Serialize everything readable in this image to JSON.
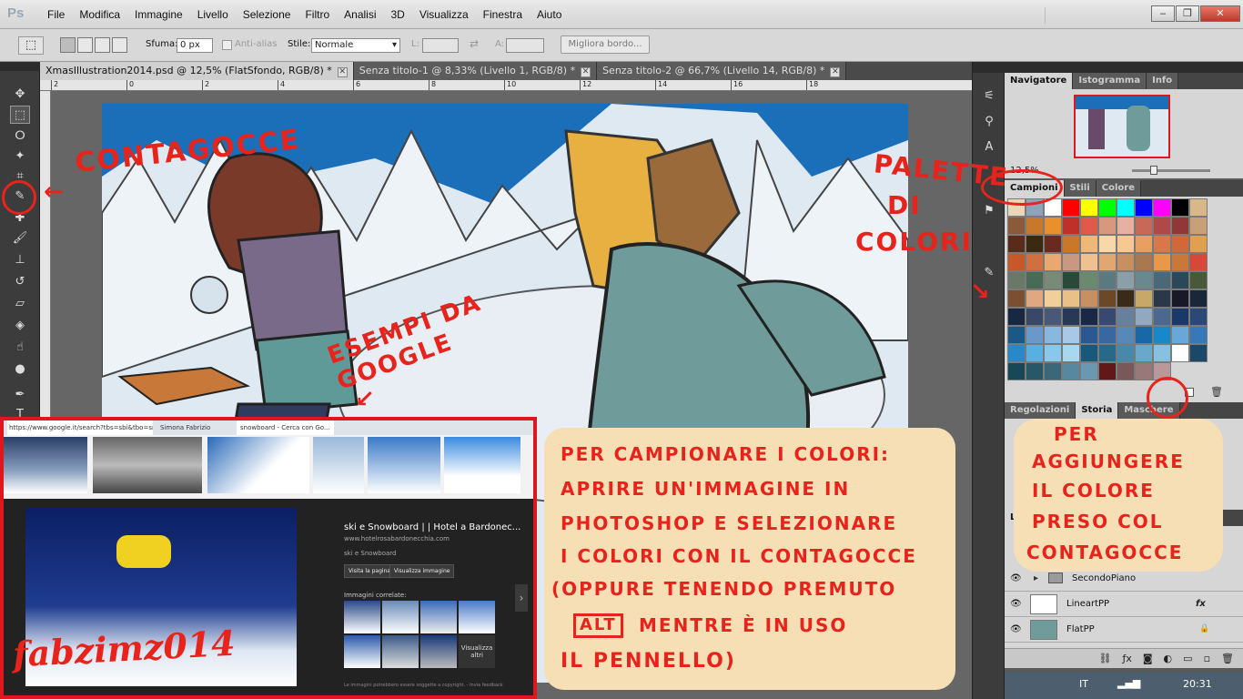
{
  "app": {
    "logo": "Ps"
  },
  "menu": [
    "File",
    "Modifica",
    "Immagine",
    "Livello",
    "Selezione",
    "Filtro",
    "Analisi",
    "3D",
    "Visualizza",
    "Finestra",
    "Aiuto"
  ],
  "options": {
    "feather_label": "Sfuma:",
    "feather_value": "0 px",
    "antialias_label": "Anti-alias",
    "style_label": "Stile:",
    "style_value": "Normale",
    "width_label": "L:",
    "height_label": "A:",
    "refine_button": "Migliora bordo..."
  },
  "tabs": [
    "XmasIllustration2014.psd @ 12,5% (FlatSfondo, RGB/8) *",
    "Senza titolo-1 @ 8,33% (Livello 1, RGB/8) *",
    "Senza titolo-2 @ 66,7% (Livello 14, RGB/8) *"
  ],
  "ruler_ticks": [
    "2",
    "0",
    "2",
    "4",
    "6",
    "8",
    "10",
    "12",
    "14",
    "16",
    "18"
  ],
  "navigator": {
    "tabs": [
      "Navigatore",
      "Istogramma",
      "Info"
    ],
    "zoom": "12,5%"
  },
  "swatches": {
    "tabs": [
      "Campioni",
      "Stili",
      "Colore"
    ],
    "colors": [
      "#e8d7b8",
      "#8fa4b8",
      "#ffffff",
      "#ff0000",
      "#ffff00",
      "#00ff00",
      "#00ffff",
      "#0000ff",
      "#ff00ff",
      "#000000",
      "#d8b888",
      "#8a5a3a",
      "#c8782a",
      "#e8902a",
      "#c0302a",
      "#e05a4a",
      "#d89880",
      "#e8b0a0",
      "#c86858",
      "#b04848",
      "#903838",
      "#c8a078",
      "#5a2a1a",
      "#3a2a10",
      "#6a2a20",
      "#c87828",
      "#f0b878",
      "#f8d8a8",
      "#f8c890",
      "#e8a060",
      "#d87848",
      "#d06838",
      "#e0a050",
      "#c85828",
      "#d07040",
      "#e8a870",
      "#c89880",
      "#f0c090",
      "#e0a870",
      "#c89060",
      "#a87850",
      "#e89848",
      "#c87838",
      "#d84838",
      "#6a7868",
      "#4a6a58",
      "#7a8a78",
      "#2a4a38",
      "#6a8a70",
      "#5a7a80",
      "#8aa0a8",
      "#6a8890",
      "#4a6878",
      "#2a4858",
      "#485838",
      "#7a5030",
      "#e0a880",
      "#f0d098",
      "#e8c088",
      "#c89060",
      "#6a4828",
      "#3a2a18",
      "#c8a868",
      "#2a3848",
      "#181828",
      "#182838",
      "#182840",
      "#384868",
      "#4a5878",
      "#2a3858",
      "#1a2848",
      "#384870",
      "#6880a0",
      "#90a8c0",
      "#4a6890",
      "#1a3868",
      "#2a4878",
      "#1a5888",
      "#6a98c8",
      "#88b8e0",
      "#a8c8e8",
      "#2a5890",
      "#3868a0",
      "#5888b8",
      "#1868a8",
      "#1888c8",
      "#68a8d8",
      "#3878b8",
      "#2888c8",
      "#58b0e0",
      "#88c8e8",
      "#a8d8f0",
      "#18587a",
      "#286888",
      "#4888a8",
      "#68a8c8",
      "#88c0e0",
      "#ffffff",
      "#1a4868",
      "#184858",
      "#285868",
      "#3a6878",
      "#5888a0",
      "#6a98b0",
      "#601818",
      "#785858",
      "#987878",
      "#b89898"
    ]
  },
  "history": {
    "tabs": [
      "Regolazioni",
      "Storia",
      "Maschere"
    ]
  },
  "layers": {
    "title": "Li",
    "items": [
      {
        "name": "SecondoPiano",
        "type": "group"
      },
      {
        "name": "LineartPP",
        "type": "layer",
        "fx": "fx"
      },
      {
        "name": "FlatPP",
        "type": "layer"
      }
    ]
  },
  "taskbar": {
    "language": "IT",
    "time": "20:31"
  },
  "browser": {
    "url": "https://www.google.it/search?tbs=sbi&tbo=snbgbsdbs",
    "tab2": "Simona Fabrizio",
    "tab3": "snowboard - Cerca con Go...",
    "result_title": "ski e Snowboard | | Hotel a Bardonec...",
    "result_url": "www.hotelrosabardonecchia.com",
    "result_sub": "ski e Snowboard",
    "btn_visit": "Visita la pagina",
    "btn_view": "Visualizza immagine",
    "related_label": "Immagini correlate:",
    "more_label": "Visualizza altri",
    "footer": "Le immagini potrebbero essere soggette a copyright. - Invia feedback"
  },
  "annotations": {
    "eyedropper": "contagocce",
    "palette_1": "palette",
    "palette_2": "di",
    "palette_3": "colori",
    "google": "esempi da google",
    "main_line1": "Per campionare i colori:",
    "main_line2": "aprire un'immagine in",
    "main_line3": "Photoshop e selezionare",
    "main_line4": "i colori con il contagocce",
    "main_line5": "(oppure tenendo premuto",
    "main_alt": "alt",
    "main_line6": "mentre è in uso",
    "main_line7": "il pennello)",
    "add_line1": "Per",
    "add_line2": "aggiungere",
    "add_line3": "il colore",
    "add_line4": "preso col",
    "add_line5": "contagocce",
    "signature": "fabzimz014"
  },
  "colors": {
    "annotation_red": "#e8231b",
    "bubble": "#f7dfb5",
    "sky": "#1a6fb8"
  }
}
